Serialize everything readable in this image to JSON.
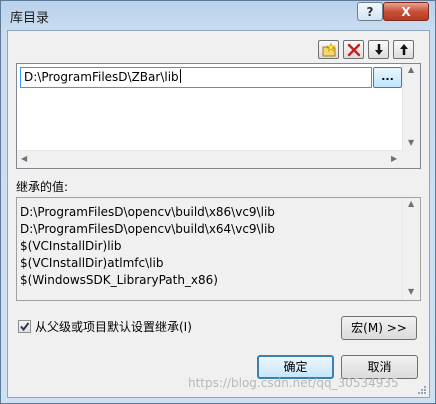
{
  "window": {
    "title": "库目录",
    "help_label": "?",
    "close_label": "X"
  },
  "toolbar": {
    "icons": [
      "new-folder-icon",
      "delete-icon",
      "move-down-icon",
      "move-up-icon"
    ]
  },
  "paths": {
    "current_value": "D:\\ProgramFilesD\\ZBar\\lib",
    "browse_label": "..."
  },
  "inherited": {
    "label": "继承的值:",
    "values": [
      "D:\\ProgramFilesD\\opencv\\build\\x86\\vc9\\lib",
      "D:\\ProgramFilesD\\opencv\\build\\x64\\vc9\\lib",
      "$(VCInstallDir)lib",
      "$(VCInstallDir)atlmfc\\lib",
      "$(WindowsSDK_LibraryPath_x86)"
    ]
  },
  "inherit_option": {
    "label": "从父级或项目默认设置继承(I)",
    "checked": true
  },
  "buttons": {
    "macro": "宏(M) >>",
    "ok": "确定",
    "cancel": "取消"
  },
  "watermark": "https://blog.csdn.net/qq_30534935",
  "colors": {
    "accent": "#3399ff",
    "title_bg": "#b9d1ea",
    "close_red": "#c8503a"
  }
}
